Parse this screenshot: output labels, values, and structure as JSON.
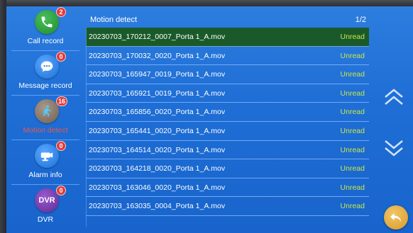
{
  "sidebar": {
    "items": [
      {
        "label": "Call record",
        "badge": "2",
        "icon": "phone-icon",
        "color": "#2e9a3c"
      },
      {
        "label": "Message record",
        "badge": "0",
        "icon": "message-icon",
        "color": "#2f86e8"
      },
      {
        "label": "Motion detect",
        "badge": "16",
        "icon": "motion-icon",
        "color": "#8a7a6a"
      },
      {
        "label": "Alarm info",
        "badge": "0",
        "icon": "camera-icon",
        "color": "#2f86e8"
      },
      {
        "label": "DVR",
        "badge": "0",
        "icon": "dvr-icon",
        "icon_text": "DVR",
        "color": "#7a3fb0"
      }
    ]
  },
  "list": {
    "title": "Motion detect",
    "page": "1/2",
    "rows": [
      {
        "name": "20230703_170212_0007_Porta 1_A.mov",
        "status": "Unread"
      },
      {
        "name": "20230703_170032_0020_Porta 1_A.mov",
        "status": "Unread"
      },
      {
        "name": "20230703_165947_0019_Porta 1_A.mov",
        "status": "Unread"
      },
      {
        "name": "20230703_165921_0019_Porta 1_A.mov",
        "status": "Unread"
      },
      {
        "name": "20230703_165856_0020_Porta 1_A.mov",
        "status": "Unread"
      },
      {
        "name": "20230703_165441_0020_Porta 1_A.mov",
        "status": "Unread"
      },
      {
        "name": "20230703_164514_0020_Porta 1_A.mov",
        "status": "Unread"
      },
      {
        "name": "20230703_164218_0020_Porta 1_A.mov",
        "status": "Unread"
      },
      {
        "name": "20230703_163046_0020_Porta 1_A.mov",
        "status": "Unread"
      },
      {
        "name": "20230703_163035_0004_Porta 1_A.mov",
        "status": "Unread"
      }
    ]
  },
  "controls": {
    "up_icon": "double-chevron-up-icon",
    "down_icon": "double-chevron-down-icon",
    "back_icon": "back-arrow-icon"
  },
  "colors": {
    "background": "#1f6fd6",
    "selected_row": "#1a5a2a",
    "unread": "#c8e64a",
    "active_label": "#e65a4a",
    "badge": "#e23b3b"
  }
}
